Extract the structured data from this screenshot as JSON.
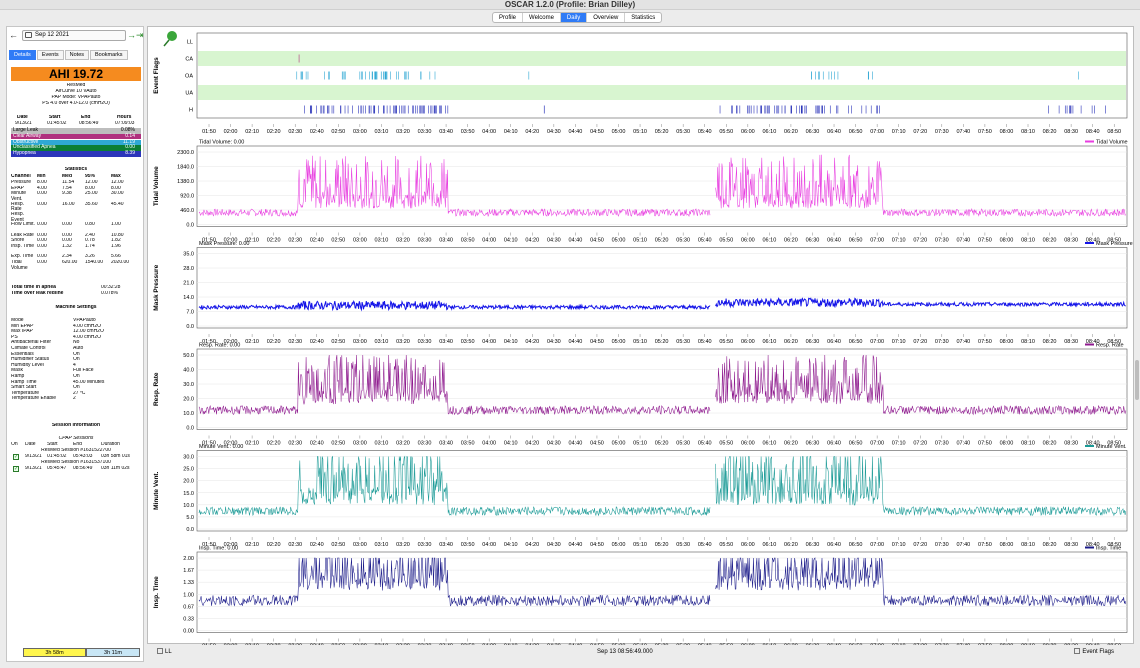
{
  "window": {
    "title": "OSCAR 1.2.0 (Profile: Brian Dilley)"
  },
  "tabs": [
    "Profile",
    "Welcome",
    "Daily",
    "Overview",
    "Statistics"
  ],
  "active_tab": "Daily",
  "sidebar": {
    "date": "Sep 12 2021",
    "subtabs": [
      "Details",
      "Events",
      "Notes",
      "Bookmarks"
    ],
    "ahi": "AHI 19.72",
    "machine": [
      "ResMed",
      "AirCurve 10 VAuto",
      "PAP Mode: VPAPauto",
      "PS 4.0 over 4.0-12.0 (cmH2O)"
    ],
    "session_header": [
      "Date",
      "Start",
      "End",
      "Hours"
    ],
    "session_row": [
      "9/13/21",
      "01:45:02",
      "08:56:49",
      "07:09:03"
    ],
    "events": [
      {
        "label": "Large Leak",
        "value": "0.08%",
        "color": "#bdbdbd"
      },
      {
        "label": "Clear Airway",
        "value": "0.14",
        "color": "#b0317e"
      },
      {
        "label": "Obstructive",
        "value": "11.19",
        "color": "#2fa8d4"
      },
      {
        "label": "Unclassified Apnea",
        "value": "0.00",
        "color": "#0c7e35"
      },
      {
        "label": "Hypopnea",
        "value": "8.39",
        "color": "#2c35ba"
      }
    ],
    "stats_title": "Statistics",
    "stats_header": [
      "Channel",
      "Min",
      "Med",
      "95%",
      "Max"
    ],
    "stats": [
      [
        "Pressure",
        "8.00",
        "11.54",
        "12.00",
        "12.00"
      ],
      [
        "EPAP",
        "4.00",
        "7.54",
        "8.00",
        "8.00"
      ],
      [
        "Minute Vent.",
        "0.00",
        "9.38",
        "25.00",
        "30.00"
      ],
      [
        "Resp. Rate",
        "0.00",
        "16.00",
        "35.60",
        "45.40"
      ],
      [
        "Resp. Event",
        "",
        "",
        "",
        ""
      ],
      [
        "Flow Limit.",
        "0.00",
        "0.00",
        "0.80",
        "1.00"
      ],
      [
        "Leak Rate",
        "0.00",
        "0.00",
        "2.40",
        "10.80"
      ],
      [
        "Snore",
        "0.00",
        "0.00",
        "0.78",
        "1.82"
      ],
      [
        "Insp. Time",
        "0.00",
        "1.32",
        "1.74",
        "1.96"
      ],
      [
        "Exp. Time",
        "0.00",
        "2.34",
        "3.26",
        "5.66"
      ],
      [
        "Tidal Volume",
        "0.00",
        "620.00",
        "1540.00",
        "2020.00"
      ]
    ],
    "apnea_time_label": "Total time in apnea",
    "apnea_time": "00:32:28",
    "leak_label": "Time over leak redline",
    "leak_value": "0.078%",
    "machine_settings_title": "Machine Settings",
    "settings": [
      [
        "Mode",
        "VPAPauto"
      ],
      [
        "Min EPAP",
        "4.00 cmH2O"
      ],
      [
        "Max IPAP",
        "12.00 cmH2O"
      ],
      [
        "PS",
        "4.00 cmH2O"
      ],
      [
        "Antibacterial Filter",
        "No"
      ],
      [
        "Climate Control",
        "Auto"
      ],
      [
        "Essentials",
        "On"
      ],
      [
        "Humidifier Status",
        "On"
      ],
      [
        "Humidity Level",
        "4"
      ],
      [
        "Mask",
        "Full Face"
      ],
      [
        "Ramp",
        "On"
      ],
      [
        "Ramp Time",
        "45.00 Minutes"
      ],
      [
        "Smart Start",
        "On"
      ],
      [
        "Temperature",
        "27 ºC"
      ],
      [
        "Temperature Enable",
        "2"
      ]
    ],
    "session_info_title": "Session Information",
    "cpap_sessions": "CPAP Sessions",
    "sess_header": [
      "On",
      "Date",
      "Start",
      "End",
      "Duration"
    ],
    "sessions": [
      {
        "name": "ResMed Session #1631522700",
        "date": "9/13/21",
        "start": "01:45:02",
        "end": "05:43:03",
        "dur": "03h 58m 01s"
      },
      {
        "name": "ResMed Session #1631537100",
        "date": "9/13/21",
        "start": "05:45:47",
        "end": "08:56:49",
        "dur": "03h 11m 02s"
      }
    ],
    "bottom": [
      "3h 58m",
      "3h 11m"
    ]
  },
  "graphs": {
    "event_flags": {
      "title": "Event Flags",
      "rows": [
        "LL",
        "CA",
        "OA",
        "UA",
        "H"
      ]
    },
    "time_ticks": [
      "01:50",
      "02:00",
      "02:10",
      "02:20",
      "02:30",
      "02:40",
      "02:50",
      "03:00",
      "03:10",
      "03:20",
      "03:30",
      "03:40",
      "03:50",
      "04:00",
      "04:10",
      "04:20",
      "04:30",
      "04:40",
      "04:50",
      "05:00",
      "05:10",
      "05:20",
      "05:30",
      "05:40",
      "05:50",
      "06:00",
      "06:10",
      "06:20",
      "06:30",
      "06:40",
      "06:50",
      "07:00",
      "07:10",
      "07:20",
      "07:30",
      "07:40",
      "07:50",
      "08:00",
      "08:10",
      "08:20",
      "08:30",
      "08:40",
      "08:50"
    ],
    "charts": [
      {
        "ylabel": "Tidal Volume",
        "readout": "Tidal Volume: 0.00",
        "legend": "Tidal Volume",
        "color": "#e83ee0",
        "ticks": [
          "2300.0",
          "1840.0",
          "1380.0",
          "920.0",
          "460.0",
          "0.0"
        ],
        "max": 2300
      },
      {
        "ylabel": "Mask Pressure",
        "readout": "Mask Pressure: 0.00",
        "legend": "Mask Pressure",
        "color": "#1515e8",
        "ticks": [
          "35.0",
          "28.0",
          "21.0",
          "14.0",
          "7.0",
          "0.0"
        ],
        "max": 35
      },
      {
        "ylabel": "Resp. Rate",
        "readout": "Resp. Rate: 0.00",
        "legend": "Resp. Rate",
        "color": "#8e1a8e",
        "ticks": [
          "50.0",
          "40.0",
          "30.0",
          "20.0",
          "10.0",
          "0.0"
        ],
        "max": 50
      },
      {
        "ylabel": "Minute Vent.",
        "readout": "Minute Vent.: 0.00",
        "legend": "Minute Vent.",
        "color": "#1a9a96",
        "ticks": [
          "30.0",
          "25.0",
          "20.0",
          "15.0",
          "10.0",
          "5.0",
          "0.0"
        ],
        "max": 30
      },
      {
        "ylabel": "Insp. Time",
        "readout": "Insp. Time: 0.00",
        "legend": "Insp. Time",
        "color": "#1c1c8a",
        "ticks": [
          "2.00",
          "1.67",
          "1.33",
          "1.00",
          "0.67",
          "0.33",
          "0.00"
        ],
        "max": 2
      }
    ]
  },
  "footer": {
    "ll": "LL",
    "date": "Sep 13 08:56:49.000",
    "flags": "Event Flags"
  }
}
